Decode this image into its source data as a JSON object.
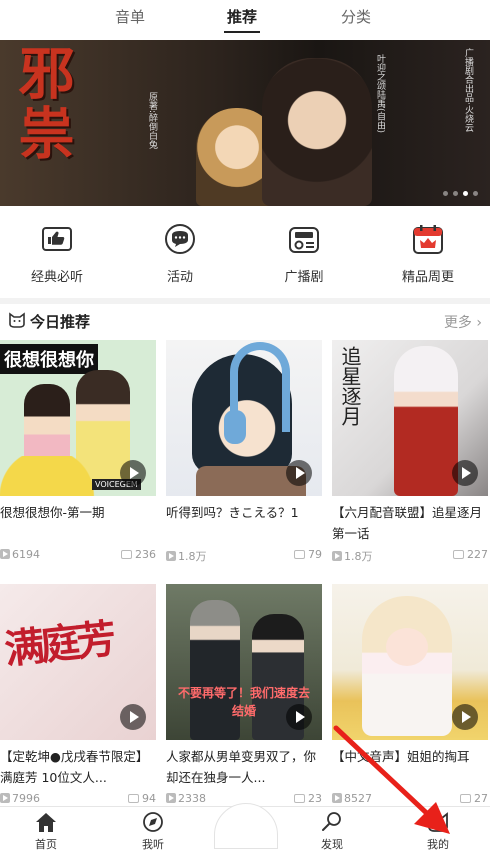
{
  "tabs": [
    {
      "label": "音单"
    },
    {
      "label": "推荐",
      "active": true
    },
    {
      "label": "分类"
    }
  ],
  "banner": {
    "title": "邪祟",
    "vtext1": "原著:醉倒白兔",
    "vtext2": "叶迎之颂陆禹(自由)",
    "vtext3": "广播剧合出品·火烧云",
    "dots": 4,
    "active_dot": 2
  },
  "quick_links": [
    {
      "label": "经典必听",
      "icon": "thumbs-up-book-icon"
    },
    {
      "label": "活动",
      "icon": "chat-bubble-icon"
    },
    {
      "label": "广播剧",
      "icon": "radio-icon"
    },
    {
      "label": "精品周更",
      "icon": "calendar-crown-icon"
    }
  ],
  "section": {
    "title": "今日推荐",
    "more": "更多",
    "icon": "cat-face-icon"
  },
  "cards": [
    {
      "title": "很想很想你-第一期",
      "plays": "6194",
      "comments": "236",
      "cover_text": "很想很想你",
      "cover_sub": "VOICEGEM"
    },
    {
      "title": "听得到吗？きこえる？1",
      "plays": "1.8万",
      "comments": "79"
    },
    {
      "title": "【六月配音联盟】追星逐月 第一话",
      "plays": "1.8万",
      "comments": "227",
      "cover_text": "追星逐月"
    },
    {
      "title": "【定乾坤●戊戌春节限定】满庭芳 10位文人...",
      "plays": "7996",
      "comments": "94",
      "cover_text": "满庭芳"
    },
    {
      "title": "人家都从男单变男双了，你却还在独身一人...",
      "plays": "2338",
      "comments": "23",
      "cover_text": "不要再等了！我们速度去结婚"
    },
    {
      "title": "【中文音声】姐姐的掏耳",
      "plays": "8527",
      "comments": "27"
    }
  ],
  "navbar": [
    {
      "label": "首页",
      "icon": "home-icon"
    },
    {
      "label": "我听",
      "icon": "compass-icon"
    },
    {
      "label": "发现",
      "icon": "search-icon"
    },
    {
      "label": "我的",
      "icon": "cat-profile-icon"
    }
  ],
  "colors": {
    "accent_red": "#e33a2f",
    "arrow": "#e8211a"
  }
}
